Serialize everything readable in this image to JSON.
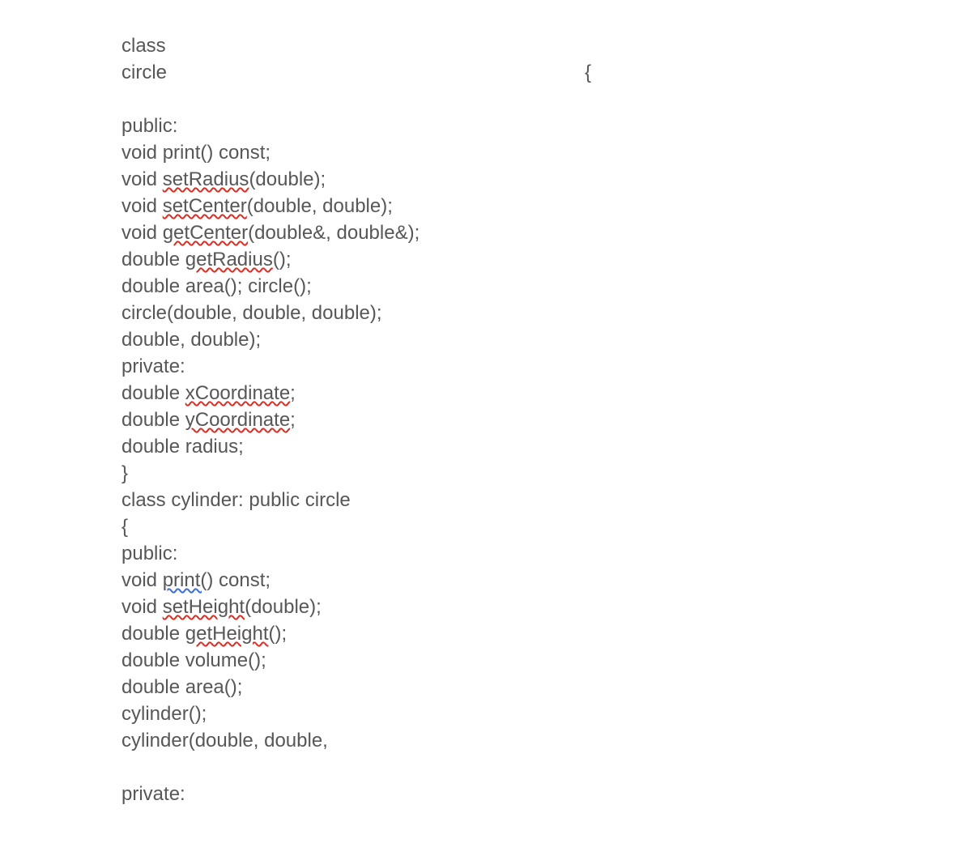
{
  "code": {
    "l1": "class",
    "l2_left": "circle",
    "l2_right": "{",
    "blank1": "",
    "l3": "public:",
    "l4": "void print() const;",
    "l5_a": "void ",
    "l5_b": "setRadius",
    "l5_c": "(double);",
    "l6_a": "void ",
    "l6_b": "setCenter",
    "l6_c": "(double, double);",
    "l7_a": "void ",
    "l7_b": "getCenter",
    "l7_c": "(double&, double&);",
    "l8_a": "double ",
    "l8_b": "getRadius",
    "l8_c": "();",
    "l9": "double area(); circle();",
    "l10": "circle(double, double, double);",
    "l11": "double, double);",
    "l12": "private:",
    "l13_a": "double ",
    "l13_b": "xCoordinate",
    "l13_c": ";",
    "l14_a": "double ",
    "l14_b": "yCoordinate",
    "l14_c": ";",
    "l15": "double radius;",
    "l16": "}",
    "l17": "class cylinder: public circle",
    "l18": "{",
    "l19": "public:",
    "l20_a": "void ",
    "l20_b": "print(",
    "l20_c": ") const;",
    "l21_a": "void ",
    "l21_b": "setHeight",
    "l21_c": "(double);",
    "l22_a": "double ",
    "l22_b": "getHeight",
    "l22_c": "();",
    "l23": "double volume();",
    "l24": "double area();",
    "l25": "cylinder();",
    "l26": "cylinder(double, double,",
    "blank2": "",
    "l27": "private:"
  }
}
